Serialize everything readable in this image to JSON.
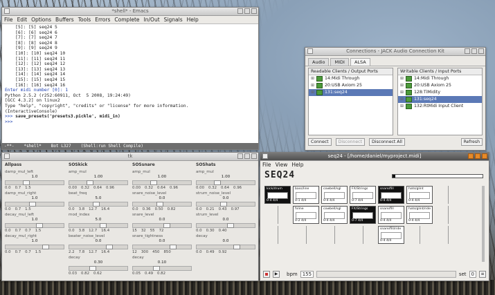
{
  "emacs": {
    "title": "*shell* - Emacs",
    "menu": [
      "File",
      "Edit",
      "Options",
      "Buffers",
      "Tools",
      "Errors",
      "Complete",
      "In/Out",
      "Signals",
      "Help"
    ],
    "lines": [
      "    [5]: [5] seq24 5",
      "    [6]: [6] seq24 6",
      "    [7]: [7] seq24 7",
      "    [8]: [8] seq24 8",
      "    [9]: [9] seq24 9",
      "    [10]: [10] seq24 10",
      "    [11]: [11] seq24 11",
      "    [12]: [12] seq24 12",
      "    [13]: [13] seq24 13",
      "    [14]: [14] seq24 14",
      "    [15]: [15] seq24 15",
      "    [16]: [16] seq24 16"
    ],
    "prompt_line": "Enter midi number [0]: 1",
    "python_lines": [
      "Python 2.5.2 (r252:60911, Oct  5 2008, 19:24:49)",
      "[GCC 4.3.2] on linux2",
      "Type \"help\", \"copyright\", \"credits\" or \"license\" for more information.",
      "(InteractiveConsole)"
    ],
    "command_prompt": ">>> ",
    "command": "save_presets('presets3.pickle', midi_in)",
    "last_prompt": ">>> ",
    "modeline": [
      "-**-",
      "*shell*",
      "Bot L327",
      "(Shell:run Shell Compile)"
    ]
  },
  "jack": {
    "title": "Connections - JACK Audio Connection Kit",
    "tabs": [
      "Audio",
      "MIDI",
      "ALSA"
    ],
    "readable_header": "Readable Clients / Output Ports",
    "writable_header": "Writable Clients / Input Ports",
    "readable": [
      "14:Midi Through",
      "20:USB Axiom 25",
      "131:seq24"
    ],
    "writable": [
      "14:Midi Through",
      "20:USB Axiom 25",
      "128:TiMidity",
      "131:seq24",
      "132:RtMidi Input Client"
    ],
    "buttons": {
      "connect": "Connect",
      "disconnect": "Disconnect",
      "disconnect_all": "Disconnect All",
      "refresh": "Refresh"
    }
  },
  "tk": {
    "title": "tk",
    "columns": [
      {
        "name": "Allpass",
        "rows": [
          {
            "label": "damp_mul_left",
            "value": "1.0",
            "vals": [
              "0.0",
              "0.7",
              "1.5"
            ]
          },
          {
            "label": "damp_mul_right",
            "value": "1.0",
            "vals": [
              "0.0",
              "0.7",
              "1.5"
            ]
          },
          {
            "label": "decay_mul_left",
            "value": "1.0",
            "vals": [
              "0.0",
              "0.7",
              "0.7",
              "1.5"
            ]
          },
          {
            "label": "decay_mul_right",
            "value": "1.0",
            "vals": [
              "0.0",
              "0.7",
              "0.7",
              "1.5"
            ]
          }
        ]
      },
      {
        "name": "SOSkick",
        "rows": [
          {
            "label": "amp_mul",
            "value": "1.00",
            "vals": [
              "0.00",
              "0.32",
              "0.64",
              "0.96"
            ]
          },
          {
            "label": "beat_freq",
            "value": "5.0",
            "vals": [
              "0.0",
              "3.8",
              "12.7",
              "16.4"
            ]
          },
          {
            "label": "mod_index",
            "value": "5.0",
            "vals": [
              "0.0",
              "3.8",
              "12.7",
              "16.4"
            ]
          },
          {
            "label": "beater_noise_level",
            "value": "0.0",
            "vals": [
              "2.2",
              "7.8",
              "12.7",
              "16.4"
            ]
          },
          {
            "label": "decay",
            "value": "0.30",
            "vals": [
              "0.03",
              "0.82",
              "0.62"
            ]
          }
        ]
      },
      {
        "name": "SOSsnare",
        "rows": [
          {
            "label": "amp_mul",
            "value": "1.00",
            "vals": [
              "0.00",
              "0.32",
              "0.64",
              "0.96"
            ]
          },
          {
            "label": "snare_noise_level",
            "value": "0.0",
            "vals": [
              "0.0",
              "0.36",
              "0.50",
              "0.82"
            ]
          },
          {
            "label": "snare_level",
            "value": "0.0",
            "vals": [
              "15",
              "32",
              "55",
              "72"
            ]
          },
          {
            "label": "snare_tightness",
            "value": "0.0",
            "vals": [
              "12",
              "300",
              "450",
              "850"
            ]
          },
          {
            "label": "decay",
            "value": "0.10",
            "vals": [
              "0.05",
              "0.49",
              "0.82"
            ]
          }
        ]
      },
      {
        "name": "SOShats",
        "rows": [
          {
            "label": "amp_mul",
            "value": "1.00",
            "vals": [
              "0.00",
              "0.32",
              "0.64",
              "0.96"
            ]
          },
          {
            "label": "strum_noise_level",
            "value": "0.0",
            "vals": [
              "0.0",
              "0.21",
              "0.43",
              "0.97"
            ]
          },
          {
            "label": "strum_level",
            "value": "0.0",
            "vals": [
              "0.0",
              "0.30",
              "0.40"
            ]
          },
          {
            "label": "decay",
            "value": "0.0",
            "vals": [
              "0.0",
              "0.49",
              "0.92"
            ]
          }
        ]
      }
    ]
  },
  "seq": {
    "title": "seq24 - [/home/daniel/myproject.midi]",
    "menu": [
      "File",
      "View",
      "Help"
    ],
    "logo": "SEQ24",
    "patterns": [
      {
        "name": "kick/drum",
        "sig": "0-4 4/4",
        "on": true
      },
      {
        "name": "bass/line",
        "sig": "0-1 4/4",
        "on": false
      },
      {
        "name": "cowbell/sgl",
        "sig": "0-4 4/4",
        "on": false
      },
      {
        "name": "FX/Strings",
        "sig": "0-7 4/4",
        "on": false
      },
      {
        "name": "snare/fill",
        "sig": "0-4 4/4",
        "on": true
      },
      {
        "name": "hats/glint",
        "sig": "0-4 4/4",
        "on": false
      },
      {
        "name": "",
        "sig": "",
        "on": false
      },
      {
        "name": "",
        "sig": "",
        "on": false
      },
      {
        "name": "fxline",
        "sig": "0-2 4/4",
        "on": false
      },
      {
        "name": "cowbell/sgl",
        "sig": "0-4 4/4",
        "on": false
      },
      {
        "name": "FX/Strings",
        "sig": "0-7 4/4",
        "on": true
      },
      {
        "name": "snare/fill",
        "sig": "0-4 4/4",
        "on": false
      },
      {
        "name": "hats/glint/ride",
        "sig": "0-4 4/4",
        "on": false
      },
      {
        "name": "",
        "sig": "",
        "on": false
      },
      {
        "name": "",
        "sig": "",
        "on": false
      },
      {
        "name": "",
        "sig": "",
        "on": false
      },
      {
        "name": "",
        "sig": "",
        "on": false
      },
      {
        "name": "",
        "sig": "",
        "on": false
      },
      {
        "name": "snare/fill/ride",
        "sig": "0-4 4/4",
        "on": false
      },
      {
        "name": "",
        "sig": "",
        "on": false
      },
      {
        "name": "",
        "sig": "",
        "on": false
      }
    ],
    "bpm_label": "bpm",
    "bpm": "155",
    "set_label": "set",
    "set": "0"
  }
}
